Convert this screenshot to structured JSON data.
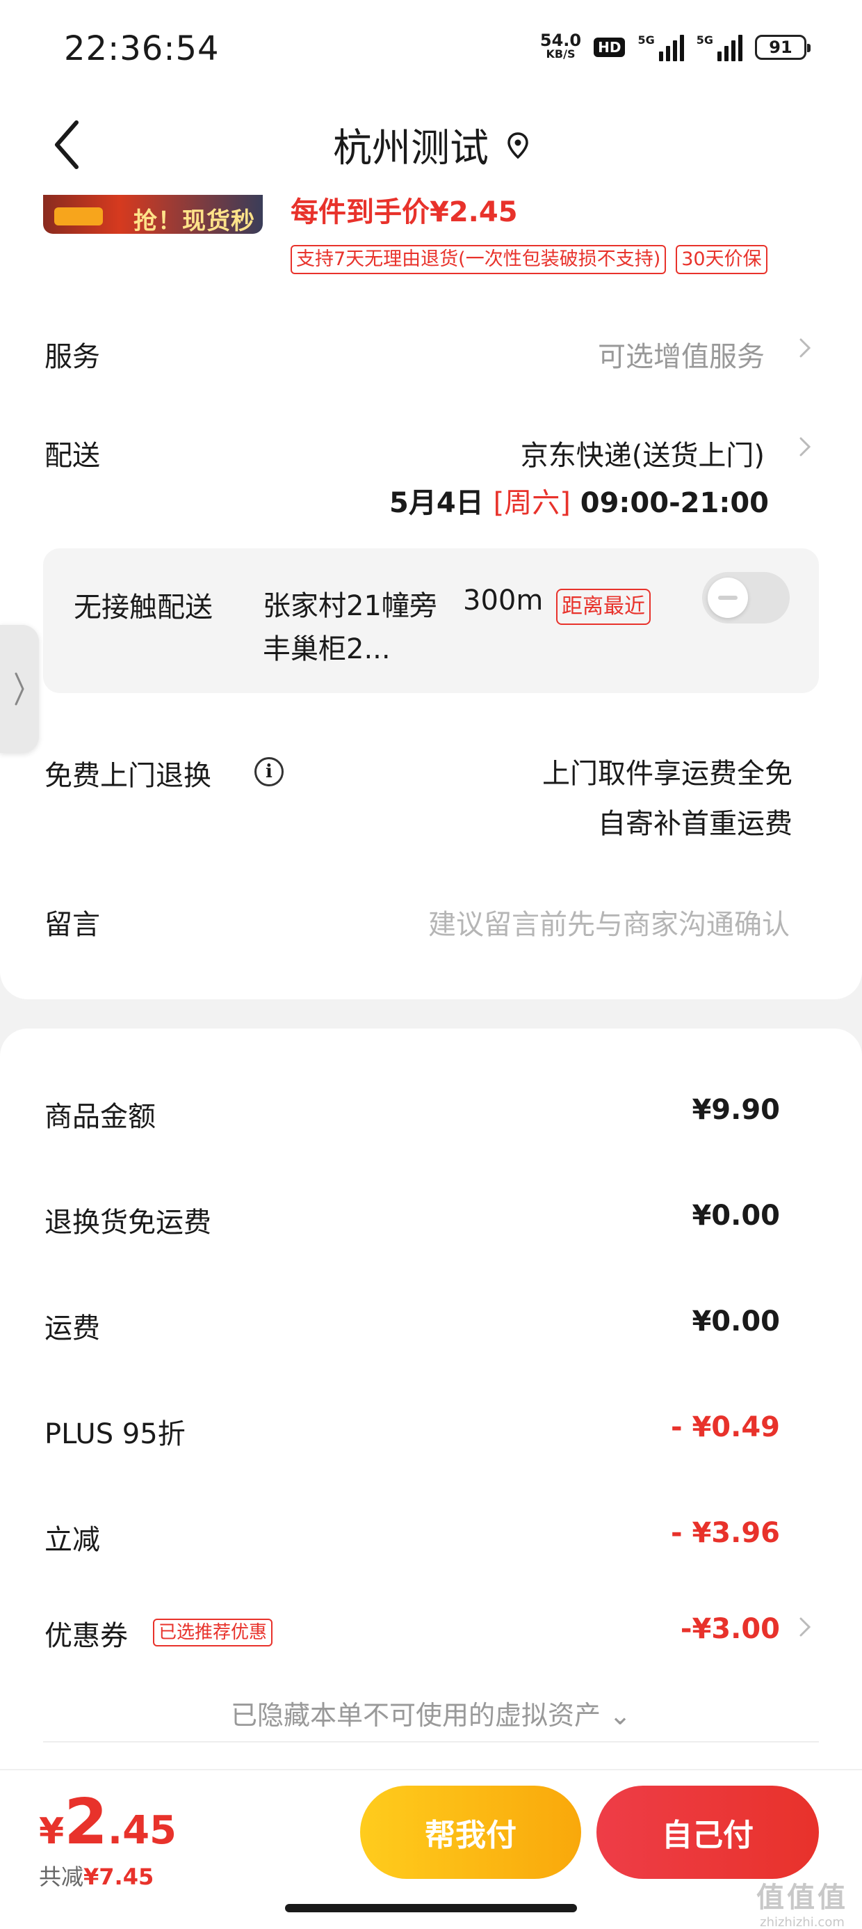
{
  "status_bar": {
    "time": "22:36:54",
    "net_speed": "54.0",
    "net_unit": "KB/S",
    "hd_label": "HD",
    "signal1_label": "5G",
    "signal2_label": "5G",
    "battery": "91"
  },
  "header": {
    "title": "杭州测试",
    "back_icon": "chevron-left-icon",
    "location_icon": "location-pin-icon"
  },
  "product": {
    "thumb_text": "抢！现货秒发",
    "price_line": "每件到手价¥2.45",
    "tags": [
      "支持7天无理由退货(一次性包装破损不支持)",
      "30天价保"
    ]
  },
  "service": {
    "label": "服务",
    "value": "可选增值服务"
  },
  "delivery": {
    "label": "配送",
    "value": "京东快递(送货上门)",
    "date": "5月4日",
    "weekday": "[周六]",
    "time_window": "09:00-21:00"
  },
  "contactless": {
    "label": "无接触配送",
    "address": "张家村21幢旁丰巢柜2...",
    "distance": "300m",
    "nearest_tag": "距离最近",
    "enabled": false
  },
  "return_service": {
    "label": "免费上门退换",
    "line1": "上门取件享运费全免",
    "line2": "自寄补首重运费"
  },
  "message": {
    "label": "留言",
    "placeholder": "建议留言前先与商家沟通确认"
  },
  "costs": {
    "goods": {
      "label": "商品金额",
      "value": "¥9.90"
    },
    "return_shipping": {
      "label": "退换货免运费",
      "value": "¥0.00"
    },
    "shipping": {
      "label": "运费",
      "value": "¥0.00"
    },
    "plus": {
      "label": "PLUS 95折",
      "value": "- ¥0.49"
    },
    "instant": {
      "label": "立减",
      "value": "- ¥3.96"
    },
    "coupon": {
      "label": "优惠券",
      "tag": "已选推荐优惠",
      "value": "-¥3.00"
    },
    "hidden_note": "已隐藏本单不可使用的虚拟资产 ⌄"
  },
  "bottom": {
    "currency": "¥",
    "total_int": "2",
    "total_dec": ".45",
    "saved_label": "共减",
    "saved_value": "¥7.45",
    "help_pay": "帮我付",
    "self_pay": "自己付"
  },
  "watermark": {
    "line1": "值值值",
    "line2": "zhizhizhi.com"
  },
  "colors": {
    "accent": "#e8322b",
    "help_btn": "#fbb416",
    "self_btn": "#ea3535"
  }
}
